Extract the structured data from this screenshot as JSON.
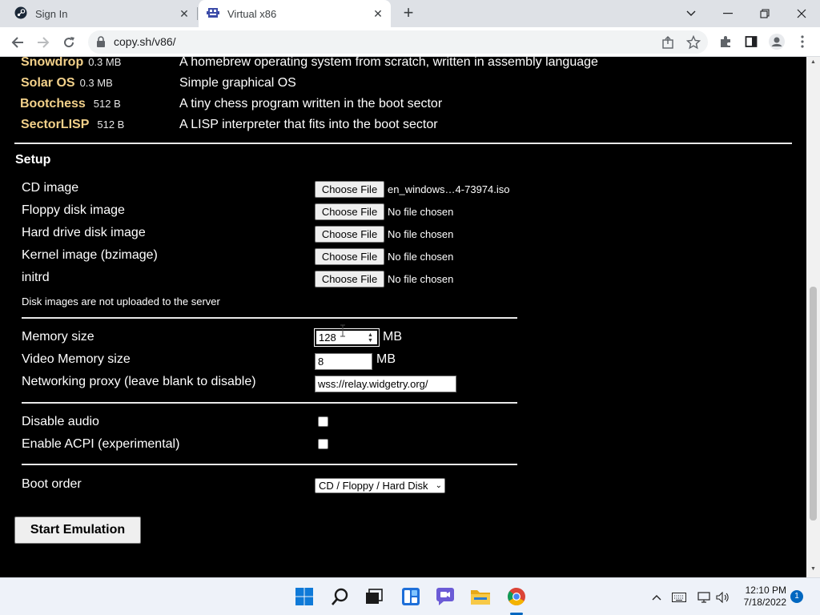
{
  "browser": {
    "tabs": [
      {
        "title": "Sign In",
        "icon": "steam-icon",
        "active": false
      },
      {
        "title": "Virtual x86",
        "icon": "v86-icon",
        "active": true
      }
    ],
    "new_tab": "+",
    "url": "copy.sh/v86/"
  },
  "os_list": [
    {
      "name": "Snowdrop",
      "size": "0.3 MB",
      "description": "A homebrew operating system from scratch, written in assembly language"
    },
    {
      "name": "Solar OS",
      "size": "0.3 MB",
      "description": "Simple graphical OS"
    },
    {
      "name": "Bootchess",
      "size": "512 B",
      "description": "A tiny chess program written in the boot sector"
    },
    {
      "name": "SectorLISP",
      "size": "512 B",
      "description": "A LISP interpreter that fits into the boot sector"
    }
  ],
  "setup": {
    "title": "Setup",
    "files": [
      {
        "label": "CD image",
        "button": "Choose File",
        "value": "en_windows…4-73974.iso"
      },
      {
        "label": "Floppy disk image",
        "button": "Choose File",
        "value": "No file chosen"
      },
      {
        "label": "Hard drive disk image",
        "button": "Choose File",
        "value": "No file chosen"
      },
      {
        "label": "Kernel image (bzimage)",
        "button": "Choose File",
        "value": "No file chosen"
      },
      {
        "label": "initrd",
        "button": "Choose File",
        "value": "No file chosen"
      }
    ],
    "note": "Disk images are not uploaded to the server",
    "memory": {
      "label": "Memory size",
      "value": "128",
      "unit": "MB"
    },
    "video_memory": {
      "label": "Video Memory size",
      "value": "8",
      "unit": "MB"
    },
    "proxy": {
      "label": "Networking proxy (leave blank to disable)",
      "value": "wss://relay.widgetry.org/"
    },
    "disable_audio": {
      "label": "Disable audio",
      "checked": false
    },
    "enable_acpi": {
      "label": "Enable ACPI (experimental)",
      "checked": false
    },
    "boot_order": {
      "label": "Boot order",
      "selected": "CD / Floppy / Hard Disk"
    },
    "start_button": "Start Emulation"
  },
  "taskbar": {
    "apps": [
      "windows-start-icon",
      "search-icon",
      "task-view-icon",
      "widgets-icon",
      "chat-icon",
      "file-explorer-icon",
      "chrome-icon"
    ],
    "time": "12:10 PM",
    "date": "7/18/2022",
    "notifications": "1"
  },
  "colors": {
    "page_bg": "#000000",
    "os_name": "#f3d18a",
    "taskbar_accent": "#0067c0"
  }
}
